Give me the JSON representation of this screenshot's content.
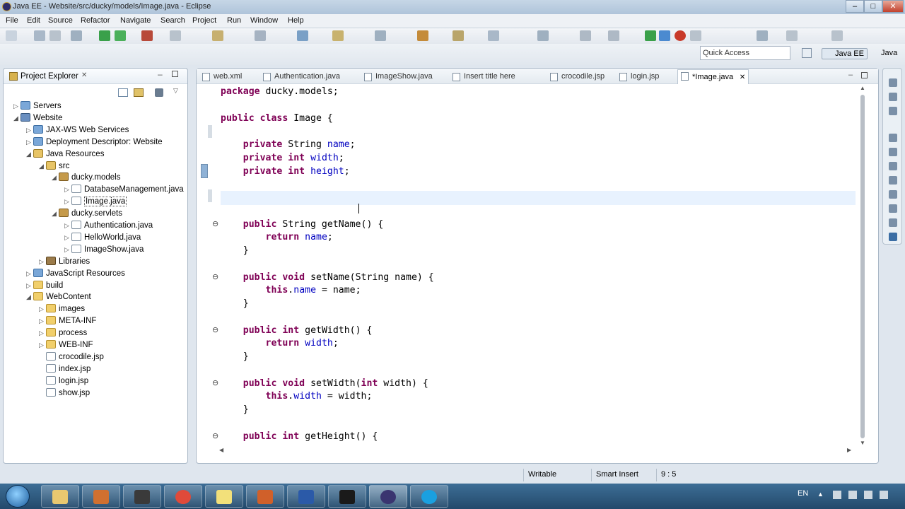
{
  "window": {
    "title": "Java EE - Website/src/ducky/models/Image.java - Eclipse"
  },
  "menu": [
    "File",
    "Edit",
    "Source",
    "Refactor",
    "Navigate",
    "Search",
    "Project",
    "Run",
    "Window",
    "Help"
  ],
  "quick_access": {
    "placeholder": "Quick Access",
    "value": "Quick Access"
  },
  "perspectives": [
    "Java EE",
    "Java"
  ],
  "explorer": {
    "title": "Project Explorer",
    "items": [
      {
        "label": "Servers",
        "depth": 1,
        "twisty": "▷",
        "icon": "srv"
      },
      {
        "label": "Website",
        "depth": 1,
        "twisty": "◢",
        "icon": "proj"
      },
      {
        "label": "JAX-WS Web Services",
        "depth": 2,
        "twisty": "▷",
        "icon": "srv"
      },
      {
        "label": "Deployment Descriptor: Website",
        "depth": 2,
        "twisty": "▷",
        "icon": "srv"
      },
      {
        "label": "Java Resources",
        "depth": 2,
        "twisty": "◢",
        "icon": "src"
      },
      {
        "label": "src",
        "depth": 3,
        "twisty": "◢",
        "icon": "src"
      },
      {
        "label": "ducky.models",
        "depth": 4,
        "twisty": "◢",
        "icon": "pkg"
      },
      {
        "label": "DatabaseManagement.java",
        "depth": 5,
        "twisty": "▷",
        "icon": "file"
      },
      {
        "label": "Image.java",
        "depth": 5,
        "twisty": "▷",
        "icon": "file",
        "selected": true
      },
      {
        "label": "ducky.servlets",
        "depth": 4,
        "twisty": "◢",
        "icon": "pkg"
      },
      {
        "label": "Authentication.java",
        "depth": 5,
        "twisty": "▷",
        "icon": "file"
      },
      {
        "label": "HelloWorld.java",
        "depth": 5,
        "twisty": "▷",
        "icon": "file"
      },
      {
        "label": "ImageShow.java",
        "depth": 5,
        "twisty": "▷",
        "icon": "file"
      },
      {
        "label": "Libraries",
        "depth": 3,
        "twisty": "▷",
        "icon": "lib"
      },
      {
        "label": "JavaScript Resources",
        "depth": 2,
        "twisty": "▷",
        "icon": "srv"
      },
      {
        "label": "build",
        "depth": 2,
        "twisty": "▷",
        "icon": "folder"
      },
      {
        "label": "WebContent",
        "depth": 2,
        "twisty": "◢",
        "icon": "folder"
      },
      {
        "label": "images",
        "depth": 3,
        "twisty": "▷",
        "icon": "folder"
      },
      {
        "label": "META-INF",
        "depth": 3,
        "twisty": "▷",
        "icon": "folder"
      },
      {
        "label": "process",
        "depth": 3,
        "twisty": "▷",
        "icon": "folder"
      },
      {
        "label": "WEB-INF",
        "depth": 3,
        "twisty": "▷",
        "icon": "folder"
      },
      {
        "label": "crocodile.jsp",
        "depth": 3,
        "twisty": "",
        "icon": "file"
      },
      {
        "label": "index.jsp",
        "depth": 3,
        "twisty": "",
        "icon": "file"
      },
      {
        "label": "login.jsp",
        "depth": 3,
        "twisty": "",
        "icon": "file"
      },
      {
        "label": "show.jsp",
        "depth": 3,
        "twisty": "",
        "icon": "file"
      }
    ]
  },
  "editor_tabs": [
    "web.xml",
    "Authentication.java",
    "ImageShow.java",
    "Insert title here",
    "crocodile.jsp",
    "login.jsp",
    "*Image.java"
  ],
  "active_tab": "*Image.java",
  "code_lines": [
    [
      [
        "kw",
        "package"
      ],
      [
        "t",
        " ducky.models;"
      ]
    ],
    [],
    [
      [
        "kw",
        "public"
      ],
      [
        "t",
        " "
      ],
      [
        "kw",
        "class"
      ],
      [
        "t",
        " Image {"
      ]
    ],
    [],
    [
      [
        "t",
        "    "
      ],
      [
        "kw",
        "private"
      ],
      [
        "t",
        " String "
      ],
      [
        "fld",
        "name"
      ],
      [
        "t",
        ";"
      ]
    ],
    [
      [
        "t",
        "    "
      ],
      [
        "kw",
        "private"
      ],
      [
        "t",
        " "
      ],
      [
        "kw",
        "int"
      ],
      [
        "t",
        " "
      ],
      [
        "fld",
        "width"
      ],
      [
        "t",
        ";"
      ]
    ],
    [
      [
        "t",
        "    "
      ],
      [
        "kw",
        "private"
      ],
      [
        "t",
        " "
      ],
      [
        "kw",
        "int"
      ],
      [
        "t",
        " "
      ],
      [
        "fld",
        "height"
      ],
      [
        "t",
        ";"
      ]
    ],
    [],
    [],
    [],
    [
      [
        "t",
        "    "
      ],
      [
        "kw",
        "public"
      ],
      [
        "t",
        " String getName() {"
      ]
    ],
    [
      [
        "t",
        "        "
      ],
      [
        "kw",
        "return"
      ],
      [
        "t",
        " "
      ],
      [
        "fld",
        "name"
      ],
      [
        "t",
        ";"
      ]
    ],
    [
      [
        "t",
        "    }"
      ]
    ],
    [],
    [
      [
        "t",
        "    "
      ],
      [
        "kw",
        "public"
      ],
      [
        "t",
        " "
      ],
      [
        "kw",
        "void"
      ],
      [
        "t",
        " setName(String name) {"
      ]
    ],
    [
      [
        "t",
        "        "
      ],
      [
        "kw",
        "this"
      ],
      [
        "t",
        "."
      ],
      [
        "fld",
        "name"
      ],
      [
        "t",
        " = name;"
      ]
    ],
    [
      [
        "t",
        "    }"
      ]
    ],
    [],
    [
      [
        "t",
        "    "
      ],
      [
        "kw",
        "public"
      ],
      [
        "t",
        " "
      ],
      [
        "kw",
        "int"
      ],
      [
        "t",
        " getWidth() {"
      ]
    ],
    [
      [
        "t",
        "        "
      ],
      [
        "kw",
        "return"
      ],
      [
        "t",
        " "
      ],
      [
        "fld",
        "width"
      ],
      [
        "t",
        ";"
      ]
    ],
    [
      [
        "t",
        "    }"
      ]
    ],
    [],
    [
      [
        "t",
        "    "
      ],
      [
        "kw",
        "public"
      ],
      [
        "t",
        " "
      ],
      [
        "kw",
        "void"
      ],
      [
        "t",
        " setWidth("
      ],
      [
        "kw",
        "int"
      ],
      [
        "t",
        " width) {"
      ]
    ],
    [
      [
        "t",
        "        "
      ],
      [
        "kw",
        "this"
      ],
      [
        "t",
        "."
      ],
      [
        "fld",
        "width"
      ],
      [
        "t",
        " = width;"
      ]
    ],
    [
      [
        "t",
        "    }"
      ]
    ],
    [],
    [
      [
        "t",
        "    "
      ],
      [
        "kw",
        "public"
      ],
      [
        "t",
        " "
      ],
      [
        "kw",
        "int"
      ],
      [
        "t",
        " getHeight() {"
      ]
    ]
  ],
  "status": {
    "writable": "Writable",
    "insert_mode": "Smart Insert",
    "position": "9 : 5"
  },
  "tray": {
    "lang": "EN"
  }
}
